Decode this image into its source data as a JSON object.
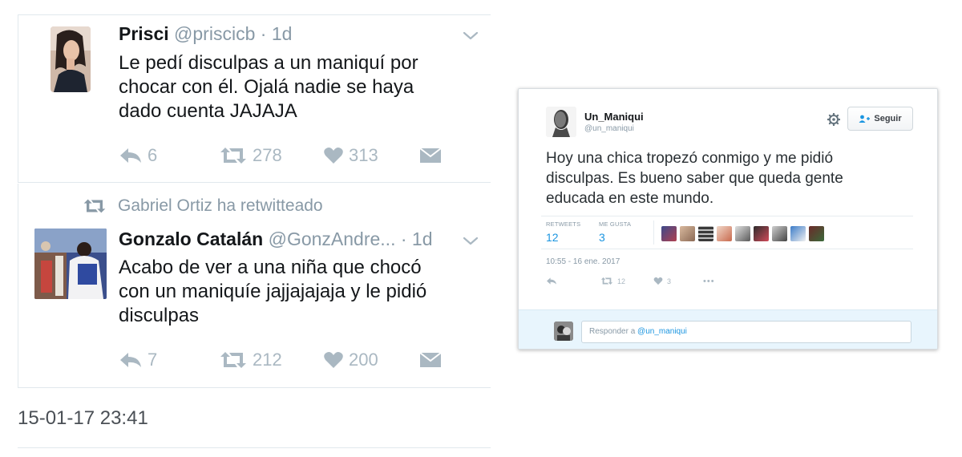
{
  "left_panel": {
    "tweet1": {
      "name": "Prisci",
      "handle": "@priscicb",
      "separator": "·",
      "time": "1d",
      "text": "Le pedí disculpas a un maniquí por\nchocar con él. Ojalá nadie se haya\ndado cuenta JAJAJA",
      "replies": "6",
      "retweets": "278",
      "likes": "313"
    },
    "tweet2": {
      "retweet_notice": "Gabriel Ortiz ha retwitteado",
      "name": "Gonzalo Catalán",
      "handle": "@GonzAndre...",
      "separator": "·",
      "time": "1d",
      "text": "Acabo de ver a una niña que chocó\ncon un maniquíe jajjajajaja y le pidió\ndisculpas",
      "replies": "7",
      "retweets": "212",
      "likes": "200"
    },
    "timestamp": "15-01-17 23:41"
  },
  "right_card": {
    "name": "Un_Maniqui",
    "handle": "@un_maniqui",
    "follow_label": "Seguir",
    "text": "Hoy una chica tropezó conmigo y me pidió\ndisculpas. Es bueno saber que queda gente\neducada en este mundo.",
    "stats": {
      "retweets_label": "RETWEETS",
      "retweets": "12",
      "likes_label": "ME GUSTA",
      "likes": "3"
    },
    "date": "10:55 - 16 ene. 2017",
    "actions": {
      "retweets": "12",
      "likes": "3",
      "more": "•••"
    },
    "reply_prefix": "Responder a",
    "reply_target": "@un_maniqui"
  },
  "icons": [
    "reply-icon",
    "retweet-icon",
    "heart-icon",
    "message-icon",
    "chevron-down-icon",
    "gear-icon",
    "follow-user-icon",
    "more-icon"
  ],
  "colors": {
    "muted": "#aab8c2",
    "handle": "#8899a6",
    "link": "#1b95e0",
    "reply_bar": "#e8f5fd"
  }
}
